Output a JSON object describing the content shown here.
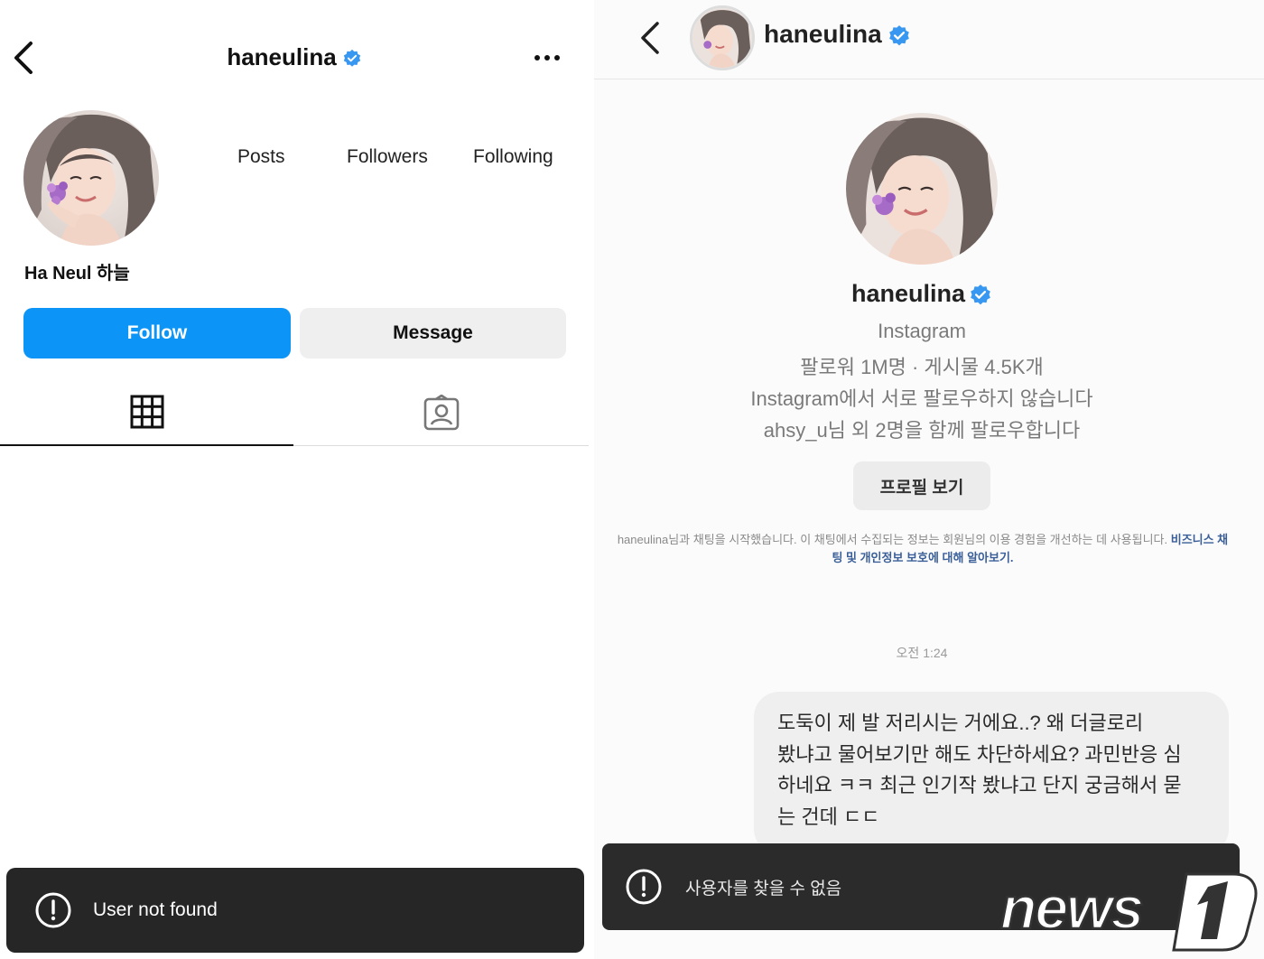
{
  "left": {
    "header": {
      "username": "haneulina",
      "back_icon": "chevron-left-icon",
      "more_icon": "more-horizontal-icon"
    },
    "stats": {
      "posts_label": "Posts",
      "followers_label": "Followers",
      "following_label": "Following"
    },
    "display_name": "Ha Neul 하늘",
    "buttons": {
      "follow": "Follow",
      "message": "Message"
    },
    "tabs": [
      {
        "icon": "grid-icon",
        "active": true
      },
      {
        "icon": "tagged-person-icon",
        "active": false
      }
    ],
    "toast": {
      "icon": "alert-circle-icon",
      "text": "User not found"
    }
  },
  "right": {
    "header": {
      "username": "haneulina"
    },
    "profile": {
      "username": "haneulina",
      "subtitle": "Instagram",
      "stats_line": "팔로워 1M명 · 게시물 4.5K개",
      "relation_line": "Instagram에서 서로 팔로우하지 않습니다",
      "mutual_line": "ahsy_u님 외 2명을 함께 팔로우합니다",
      "view_profile_button": "프로필 보기"
    },
    "notice": {
      "text": "haneulina님과 채팅을 시작했습니다. 이 채팅에서 수집되는 정보는 회원님의 이용 경험을 개선하는 데 사용됩니다.",
      "link": "비즈니스 채팅 및 개인정보 보호에 대해 알아보기."
    },
    "timestamp": "오전 1:24",
    "message": {
      "lines": [
        "도둑이 제 발 저리시는 거에요..? 왜 더글로리",
        "봤냐고 물어보기만 해도 차단하세요? 과민반응 심",
        "하네요 ㅋㅋ 최근 인기작 봤냐고 단지 궁금해서 묻",
        "는 건데 ㄷㄷ"
      ]
    },
    "toast": {
      "icon": "alert-circle-icon",
      "text": "사용자를 찾을 수 없음"
    }
  },
  "watermark": {
    "text": "news1"
  },
  "colors": {
    "follow_blue": "#0c95f6",
    "verified_blue": "#3897f0",
    "toast_bg": "#262626"
  }
}
